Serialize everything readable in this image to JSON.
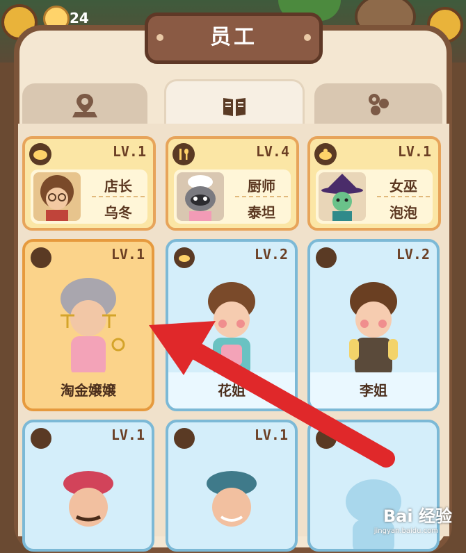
{
  "hud": {
    "count": "24"
  },
  "title": "员工",
  "tabs": [
    {
      "icon": "location-pin-icon"
    },
    {
      "icon": "book-icon"
    },
    {
      "icon": "paw-icon"
    }
  ],
  "staff": [
    {
      "role": "店长",
      "name": "乌冬",
      "level": "LV.1",
      "badge_icon": "bun-icon"
    },
    {
      "role": "厨师",
      "name": "泰坦",
      "level": "LV.4",
      "badge_icon": "fork-spoon-icon"
    },
    {
      "role": "女巫",
      "name": "泡泡",
      "level": "LV.1",
      "badge_icon": "pot-icon"
    }
  ],
  "cards": [
    {
      "name": "淘金嬢嬢",
      "level": "LV.1",
      "style": "orange"
    },
    {
      "name": "花姐",
      "level": "LV.2",
      "style": "blue"
    },
    {
      "name": "李姐",
      "level": "LV.2",
      "style": "blue"
    },
    {
      "name": "",
      "level": "LV.1",
      "style": "blue"
    },
    {
      "name": "",
      "level": "LV.1",
      "style": "blue"
    },
    {
      "name": "",
      "level": "",
      "style": "blue"
    }
  ],
  "watermark": {
    "text": "Bai 经验",
    "sub": "jingyan.baidu.com"
  },
  "colors": {
    "arrow": "#e0282a",
    "panel": "#f4e7d2",
    "frame": "#7c5439"
  }
}
